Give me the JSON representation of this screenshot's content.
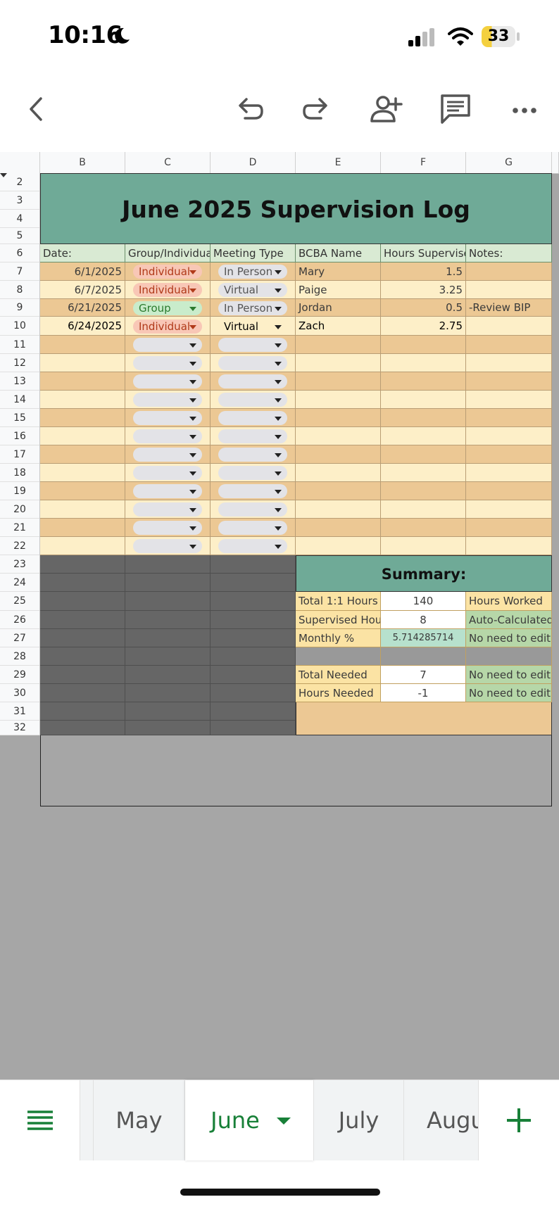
{
  "status": {
    "time": "10:16",
    "battery": "33",
    "moon_icon": "moon-icon"
  },
  "toolbar": {
    "back": "back-icon",
    "undo": "undo-icon",
    "redo": "redo-icon",
    "share": "add-person-icon",
    "comment": "comment-icon",
    "more": "more-icon"
  },
  "columns": [
    "B",
    "C",
    "D",
    "E",
    "F",
    "G"
  ],
  "rows": [
    "2",
    "3",
    "4",
    "5",
    "6",
    "7",
    "8",
    "9",
    "10",
    "11",
    "12",
    "13",
    "14",
    "15",
    "16",
    "17",
    "18",
    "19",
    "20",
    "21",
    "22",
    "23",
    "24",
    "25",
    "26",
    "27",
    "28",
    "29",
    "30",
    "31",
    "32"
  ],
  "title": "June 2025 Supervision Log",
  "headers": [
    "Date:",
    "Group/Individua",
    "Meeting Type",
    "BCBA Name",
    "Hours Supervise",
    "Notes:"
  ],
  "entries": [
    {
      "date": "6/1/2025",
      "group": "Individual",
      "meeting": "In Person",
      "bcba": "Mary",
      "hours": "1.5",
      "notes": ""
    },
    {
      "date": "6/7/2025",
      "group": "Individual",
      "meeting": "Virtual",
      "bcba": "Paige",
      "hours": "3.25",
      "notes": ""
    },
    {
      "date": "6/21/2025",
      "group": "Group",
      "meeting": "In Person",
      "bcba": "Jordan",
      "hours": "0.5",
      "notes": "-Review BIP"
    },
    {
      "date": "6/24/2025",
      "group": "Individual",
      "meeting": "Virtual",
      "bcba": "Zach",
      "hours": "2.75",
      "notes": ""
    }
  ],
  "summary": {
    "title": "Summary:",
    "rows": [
      {
        "label": "Total 1:1 Hours",
        "value": "140",
        "note": "Hours Worked"
      },
      {
        "label": "Supervised Hour",
        "value": "8",
        "note": "Auto-Calculated"
      },
      {
        "label": "Monthly %",
        "value": "5.714285714",
        "note": "No need to edit"
      },
      {
        "label": "",
        "value": "",
        "note": ""
      },
      {
        "label": "Total Needed",
        "value": "7",
        "note": "No need to edit"
      },
      {
        "label": "Hours Needed",
        "value": "-1",
        "note": "No need to edit"
      }
    ]
  },
  "tabs": {
    "menu_icon": "menu-icon",
    "items": [
      "May",
      "June",
      "July",
      "Augu"
    ],
    "add_icon": "plus-icon"
  },
  "colors": {
    "title_bg": "#6faa97",
    "header_bg": "#d9ead3",
    "row_dark": "#ecc894",
    "row_light": "#fdefc8",
    "dark_block": "#666666",
    "summary_label": "#fbe3a4",
    "summary_note_green": "#b6d7a8",
    "monthly_bg": "#b7e1cd"
  }
}
